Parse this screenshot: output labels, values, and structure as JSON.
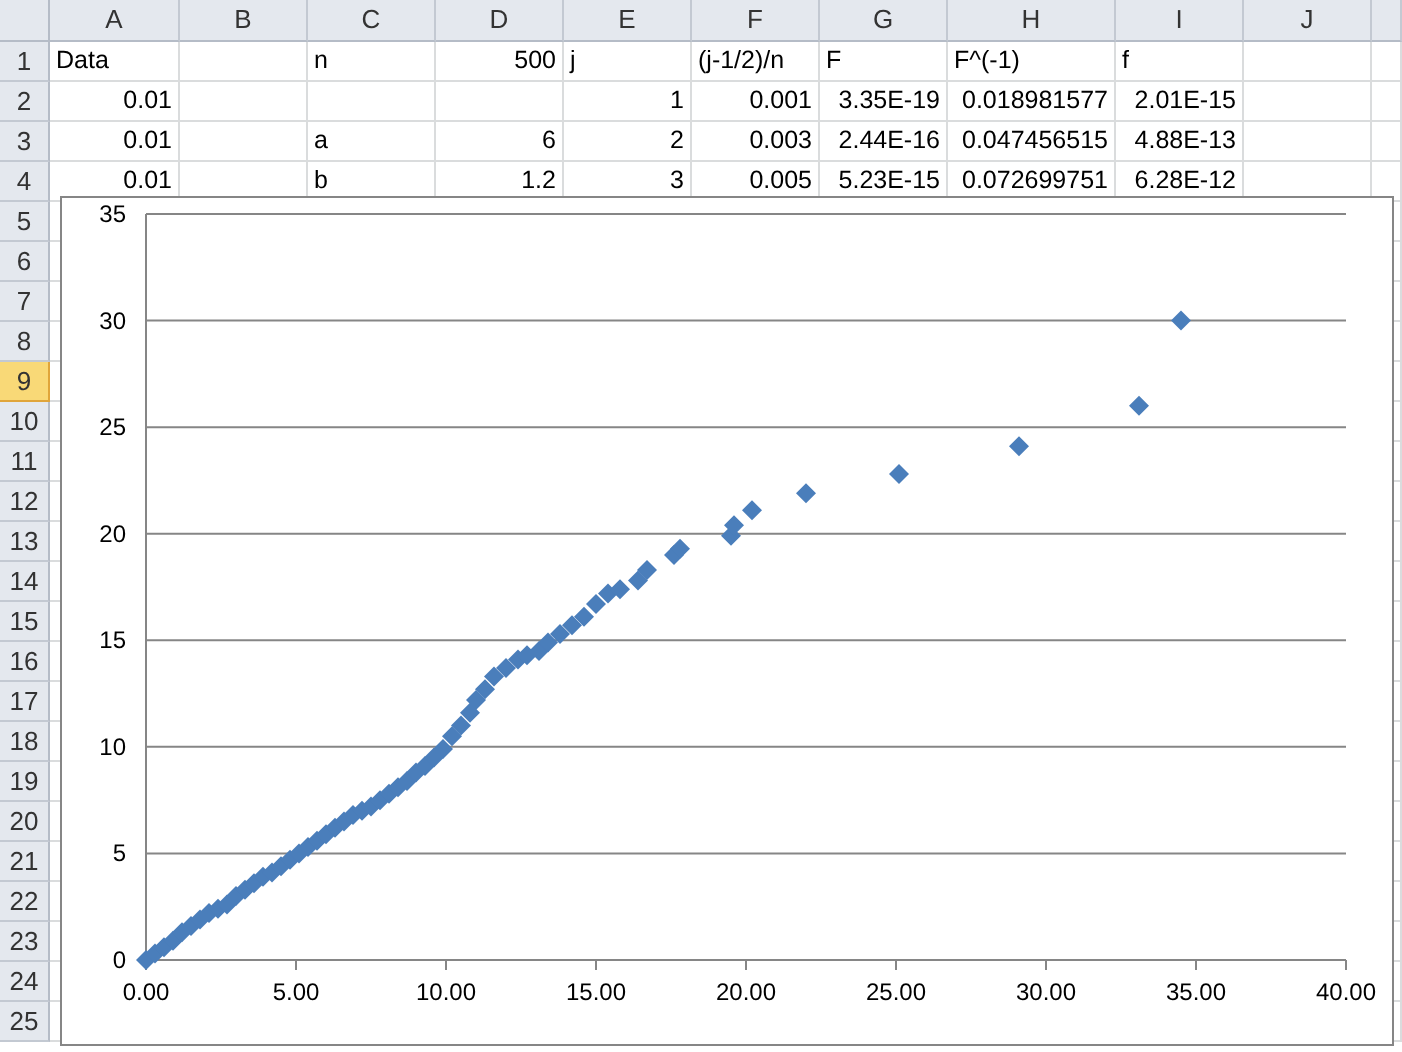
{
  "columns": [
    {
      "label": "A",
      "selected": false
    },
    {
      "label": "B",
      "selected": false
    },
    {
      "label": "C",
      "selected": false
    },
    {
      "label": "D",
      "selected": false
    },
    {
      "label": "E",
      "selected": false
    },
    {
      "label": "F",
      "selected": false
    },
    {
      "label": "G",
      "selected": false
    },
    {
      "label": "H",
      "selected": false
    },
    {
      "label": "I",
      "selected": false
    },
    {
      "label": "J",
      "selected": false
    }
  ],
  "rows": [
    {
      "header": "1",
      "selected": false,
      "cells": [
        {
          "kind": "text",
          "value": "Data"
        },
        {
          "kind": "empty"
        },
        {
          "kind": "text",
          "value": "n"
        },
        {
          "kind": "number",
          "value": "500"
        },
        {
          "kind": "text",
          "value": "j"
        },
        {
          "kind": "text",
          "value": "(j-1/2)/n"
        },
        {
          "kind": "text",
          "value": "F"
        },
        {
          "kind": "text",
          "value": "F^(-1)"
        },
        {
          "kind": "text",
          "value": "f"
        },
        {
          "kind": "empty"
        }
      ]
    },
    {
      "header": "2",
      "selected": false,
      "cells": [
        {
          "kind": "number",
          "value": "0.01"
        },
        {
          "kind": "empty"
        },
        {
          "kind": "empty"
        },
        {
          "kind": "empty"
        },
        {
          "kind": "number",
          "value": "1"
        },
        {
          "kind": "number",
          "value": "0.001"
        },
        {
          "kind": "number",
          "value": "3.35E-19"
        },
        {
          "kind": "number",
          "value": "0.018981577"
        },
        {
          "kind": "number",
          "value": "2.01E-15"
        },
        {
          "kind": "empty"
        }
      ]
    },
    {
      "header": "3",
      "selected": false,
      "cells": [
        {
          "kind": "number",
          "value": "0.01"
        },
        {
          "kind": "empty"
        },
        {
          "kind": "text",
          "value": "a"
        },
        {
          "kind": "number",
          "value": "6"
        },
        {
          "kind": "number",
          "value": "2"
        },
        {
          "kind": "number",
          "value": "0.003"
        },
        {
          "kind": "number",
          "value": "2.44E-16"
        },
        {
          "kind": "number",
          "value": "0.047456515"
        },
        {
          "kind": "number",
          "value": "4.88E-13"
        },
        {
          "kind": "empty"
        }
      ]
    },
    {
      "header": "4",
      "selected": false,
      "cells": [
        {
          "kind": "number",
          "value": "0.01"
        },
        {
          "kind": "empty"
        },
        {
          "kind": "text",
          "value": "b"
        },
        {
          "kind": "number",
          "value": "1.2"
        },
        {
          "kind": "number",
          "value": "3"
        },
        {
          "kind": "number",
          "value": "0.005"
        },
        {
          "kind": "number",
          "value": "5.23E-15"
        },
        {
          "kind": "number",
          "value": "0.072699751"
        },
        {
          "kind": "number",
          "value": "6.28E-12"
        },
        {
          "kind": "empty"
        }
      ]
    },
    {
      "header": "5",
      "selected": false
    },
    {
      "header": "6",
      "selected": false
    },
    {
      "header": "7",
      "selected": false
    },
    {
      "header": "8",
      "selected": false
    },
    {
      "header": "9",
      "selected": true
    },
    {
      "header": "10",
      "selected": false
    },
    {
      "header": "11",
      "selected": false
    },
    {
      "header": "12",
      "selected": false
    },
    {
      "header": "13",
      "selected": false
    },
    {
      "header": "14",
      "selected": false
    },
    {
      "header": "15",
      "selected": false
    },
    {
      "header": "16",
      "selected": false
    },
    {
      "header": "17",
      "selected": false
    },
    {
      "header": "18",
      "selected": false
    },
    {
      "header": "19",
      "selected": false
    },
    {
      "header": "20",
      "selected": false
    },
    {
      "header": "21",
      "selected": false
    },
    {
      "header": "22",
      "selected": false
    },
    {
      "header": "23",
      "selected": false
    },
    {
      "header": "24",
      "selected": false
    },
    {
      "header": "25",
      "selected": false
    }
  ],
  "chart_data": {
    "type": "scatter",
    "grid": true,
    "x": [
      0,
      0.3,
      0.6,
      0.9,
      1.2,
      1.5,
      1.8,
      2.1,
      2.4,
      2.7,
      3.0,
      3.3,
      3.6,
      3.9,
      4.2,
      4.5,
      4.8,
      5.1,
      5.4,
      5.7,
      6.0,
      6.3,
      6.6,
      6.9,
      7.2,
      7.5,
      7.8,
      8.1,
      8.4,
      8.7,
      9.0,
      9.3,
      9.6,
      9.9,
      10.2,
      10.5,
      10.8,
      11.0,
      11.3,
      11.6,
      12.0,
      12.4,
      12.7,
      13.1,
      13.4,
      13.8,
      14.2,
      14.6,
      15.0,
      15.4,
      15.8,
      16.4,
      16.7,
      17.6,
      17.8,
      19.5,
      19.6,
      20.2,
      22.0,
      25.1,
      29.1,
      33.1,
      34.5
    ],
    "series": [
      {
        "color": "#4a7ebb",
        "values": [
          0,
          0.3,
          0.6,
          0.9,
          1.3,
          1.6,
          1.9,
          2.2,
          2.4,
          2.6,
          3.0,
          3.3,
          3.6,
          3.9,
          4.1,
          4.4,
          4.7,
          5.0,
          5.3,
          5.6,
          5.9,
          6.2,
          6.5,
          6.8,
          7.0,
          7.2,
          7.5,
          7.8,
          8.1,
          8.4,
          8.8,
          9.1,
          9.5,
          9.9,
          10.5,
          11.0,
          11.6,
          12.2,
          12.7,
          13.3,
          13.7,
          14.1,
          14.3,
          14.5,
          14.9,
          15.3,
          15.7,
          16.1,
          16.7,
          17.2,
          17.4,
          17.8,
          18.3,
          19.0,
          19.3,
          19.9,
          20.4,
          21.1,
          21.9,
          22.8,
          24.1,
          26.0,
          30.0
        ]
      }
    ],
    "xlim": [
      0,
      40
    ],
    "ylim": [
      0,
      35
    ],
    "xticks": [
      {
        "value": 0,
        "label": "0.00"
      },
      {
        "value": 5,
        "label": "5.00"
      },
      {
        "value": 10,
        "label": "10.00"
      },
      {
        "value": 15,
        "label": "15.00"
      },
      {
        "value": 20,
        "label": "20.00"
      },
      {
        "value": 25,
        "label": "25.00"
      },
      {
        "value": 30,
        "label": "30.00"
      },
      {
        "value": 35,
        "label": "35.00"
      },
      {
        "value": 40,
        "label": "40.00"
      }
    ],
    "yticks": [
      0,
      5,
      10,
      15,
      20,
      25,
      30,
      35
    ]
  }
}
